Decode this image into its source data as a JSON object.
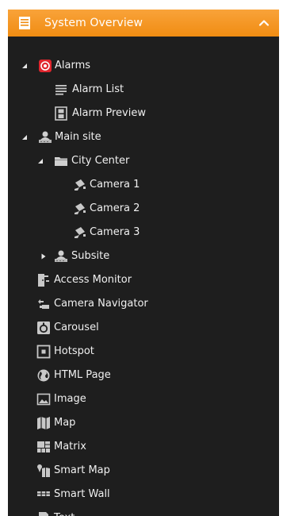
{
  "header": {
    "title": "System Overview",
    "accent": "#f7941d"
  },
  "tree": {
    "alarms": {
      "label": "Alarms",
      "children": [
        "Alarm List",
        "Alarm Preview"
      ]
    },
    "main_site": {
      "label": "Main site",
      "city_center": {
        "label": "City Center",
        "cameras": [
          "Camera 1",
          "Camera 2",
          "Camera 3"
        ]
      },
      "subsite": {
        "label": "Subsite"
      }
    },
    "views": [
      {
        "label": "Access Monitor",
        "icon": "access-monitor-icon"
      },
      {
        "label": "Camera Navigator",
        "icon": "camera-navigator-icon"
      },
      {
        "label": "Carousel",
        "icon": "carousel-icon"
      },
      {
        "label": "Hotspot",
        "icon": "hotspot-icon"
      },
      {
        "label": "HTML Page",
        "icon": "globe-icon"
      },
      {
        "label": "Image",
        "icon": "image-icon"
      },
      {
        "label": "Map",
        "icon": "map-icon"
      },
      {
        "label": "Matrix",
        "icon": "matrix-icon"
      },
      {
        "label": "Smart Map",
        "icon": "smart-map-icon"
      },
      {
        "label": "Smart Wall",
        "icon": "smart-wall-icon"
      },
      {
        "label": "Text",
        "icon": "text-icon"
      }
    ]
  }
}
